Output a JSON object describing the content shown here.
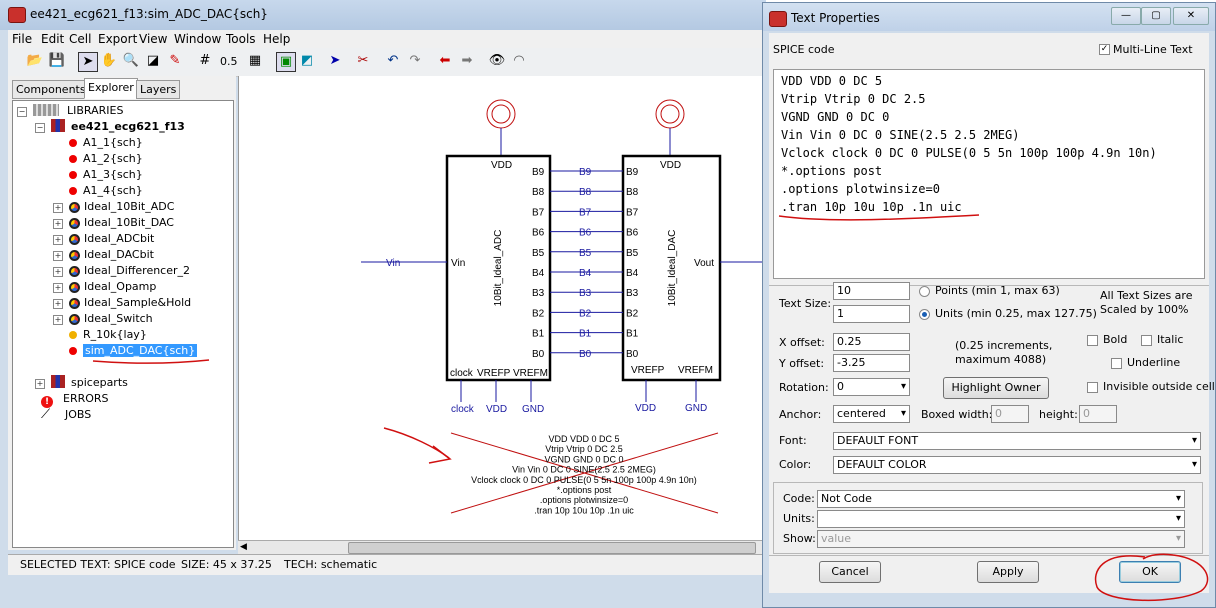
{
  "main_window": {
    "title": "ee421_ecg621_f13:sim_ADC_DAC{sch}",
    "menu": [
      "File",
      "Edit",
      "Cell",
      "Export",
      "View",
      "Window",
      "Tools",
      "Help"
    ],
    "toolbar_zoom": "0.5"
  },
  "explorer": {
    "tabs": [
      "Components",
      "Explorer",
      "Layers"
    ],
    "tree": {
      "root": "LIBRARIES",
      "library": "ee421_ecg621_f13",
      "cells": [
        {
          "label": "A1_1{sch}",
          "icon": "red-dot"
        },
        {
          "label": "A1_2{sch}",
          "icon": "red-dot"
        },
        {
          "label": "A1_3{sch}",
          "icon": "red-dot"
        },
        {
          "label": "A1_4{sch}",
          "icon": "red-dot"
        },
        {
          "label": "Ideal_10Bit_ADC",
          "icon": "cell-icon"
        },
        {
          "label": "Ideal_10Bit_DAC",
          "icon": "cell-icon"
        },
        {
          "label": "Ideal_ADCbit",
          "icon": "cell-icon"
        },
        {
          "label": "Ideal_DACbit",
          "icon": "cell-icon"
        },
        {
          "label": "Ideal_Differencer_2",
          "icon": "cell-icon"
        },
        {
          "label": "Ideal_Opamp",
          "icon": "cell-icon"
        },
        {
          "label": "Ideal_Sample&Hold",
          "icon": "cell-icon"
        },
        {
          "label": "Ideal_Switch",
          "icon": "cell-icon"
        },
        {
          "label": "R_10k{lay}",
          "icon": "orange-dot"
        },
        {
          "label": "sim_ADC_DAC{sch}",
          "icon": "red-dot",
          "selected": true
        }
      ],
      "others": [
        "spiceparts",
        "ERRORS",
        "JOBS"
      ]
    }
  },
  "schematic": {
    "adc_name": "10Bit_Ideal_ADC",
    "dac_name": "10Bit_Ideal_DAC",
    "bits": [
      "B9",
      "B8",
      "B7",
      "B6",
      "B5",
      "B4",
      "B3",
      "B2",
      "B1",
      "B0"
    ],
    "adc_pins": {
      "vdd": "VDD",
      "vin": "Vin",
      "clock": "clock",
      "vrefp": "VREFP",
      "vrefm": "VREFM"
    },
    "dac_pins": {
      "vdd": "VDD",
      "vout": "Vout",
      "vrefp": "VREFP",
      "vrefm": "VREFM"
    },
    "net_labels": {
      "vin": "Vin",
      "clock": "clock",
      "vdd1": "VDD",
      "gnd1": "GND",
      "vdd2": "VDD",
      "gnd2": "GND"
    },
    "spice_text": [
      "VDD VDD 0 DC 5",
      "Vtrip Vtrip 0 DC 2.5",
      "VGND GND 0 DC 0",
      "Vin Vin 0 DC 0 SINE(2.5 2.5 2MEG)",
      "Vclock clock 0 DC 0 PULSE(0 5 5n 100p 100p 4.9n 10n)",
      "*.options post",
      ".options plotwinsize=0",
      ".tran 10p 10u 10p .1n uic"
    ]
  },
  "status_bar": {
    "selected": "SELECTED TEXT: SPICE code",
    "size": "SIZE: 45 x 37.25",
    "tech": "TECH: schematic"
  },
  "dialog": {
    "title": "Text Properties",
    "header_label": "SPICE code",
    "multiline_label": "Multi-Line Text",
    "multiline_checked": true,
    "code_lines": [
      "VDD VDD 0 DC 5",
      "Vtrip Vtrip 0 DC 2.5",
      "VGND GND 0 DC 0",
      "Vin Vin 0 DC 0 SINE(2.5 2.5 2MEG)",
      "Vclock clock 0 DC 0 PULSE(0 5 5n 100p 100p 4.9n 10n)",
      "*.options post",
      ".options plotwinsize=0",
      ".tran 10p 10u 10p .1n uic"
    ],
    "text_size_label": "Text Size:",
    "points_value": "10",
    "units_value": "1",
    "points_label": "Points (min 1, max 63)",
    "units_label": "Units (min 0.25, max 127.75)",
    "all_text_sizes": "All Text Sizes are Scaled by 100%",
    "x_offset_label": "X offset:",
    "x_offset": "0.25",
    "y_offset_label": "Y offset:",
    "y_offset": "-3.25",
    "increments_note": "(0.25 increments, maximum 4088)",
    "bold_label": "Bold",
    "italic_label": "Italic",
    "underline_label": "Underline",
    "rotation_label": "Rotation:",
    "rotation": "0",
    "highlight_owner": "Highlight Owner",
    "invisible_label": "Invisible outside cell",
    "anchor_label": "Anchor:",
    "anchor": "centered",
    "boxed_width_label": "Boxed width:",
    "boxed_width": "0",
    "height_label": "height:",
    "height": "0",
    "font_label": "Font:",
    "font": "DEFAULT FONT",
    "color_label": "Color:",
    "color": "DEFAULT COLOR",
    "code_label": "Code:",
    "code": "Not Code",
    "units_field_label": "Units:",
    "units_field": "",
    "show_label": "Show:",
    "show": "value",
    "cancel": "Cancel",
    "apply": "Apply",
    "ok": "OK"
  },
  "colors": {
    "annotation": "#d01010",
    "net": "#1a1aa0",
    "accent_select": "#3399ff"
  }
}
